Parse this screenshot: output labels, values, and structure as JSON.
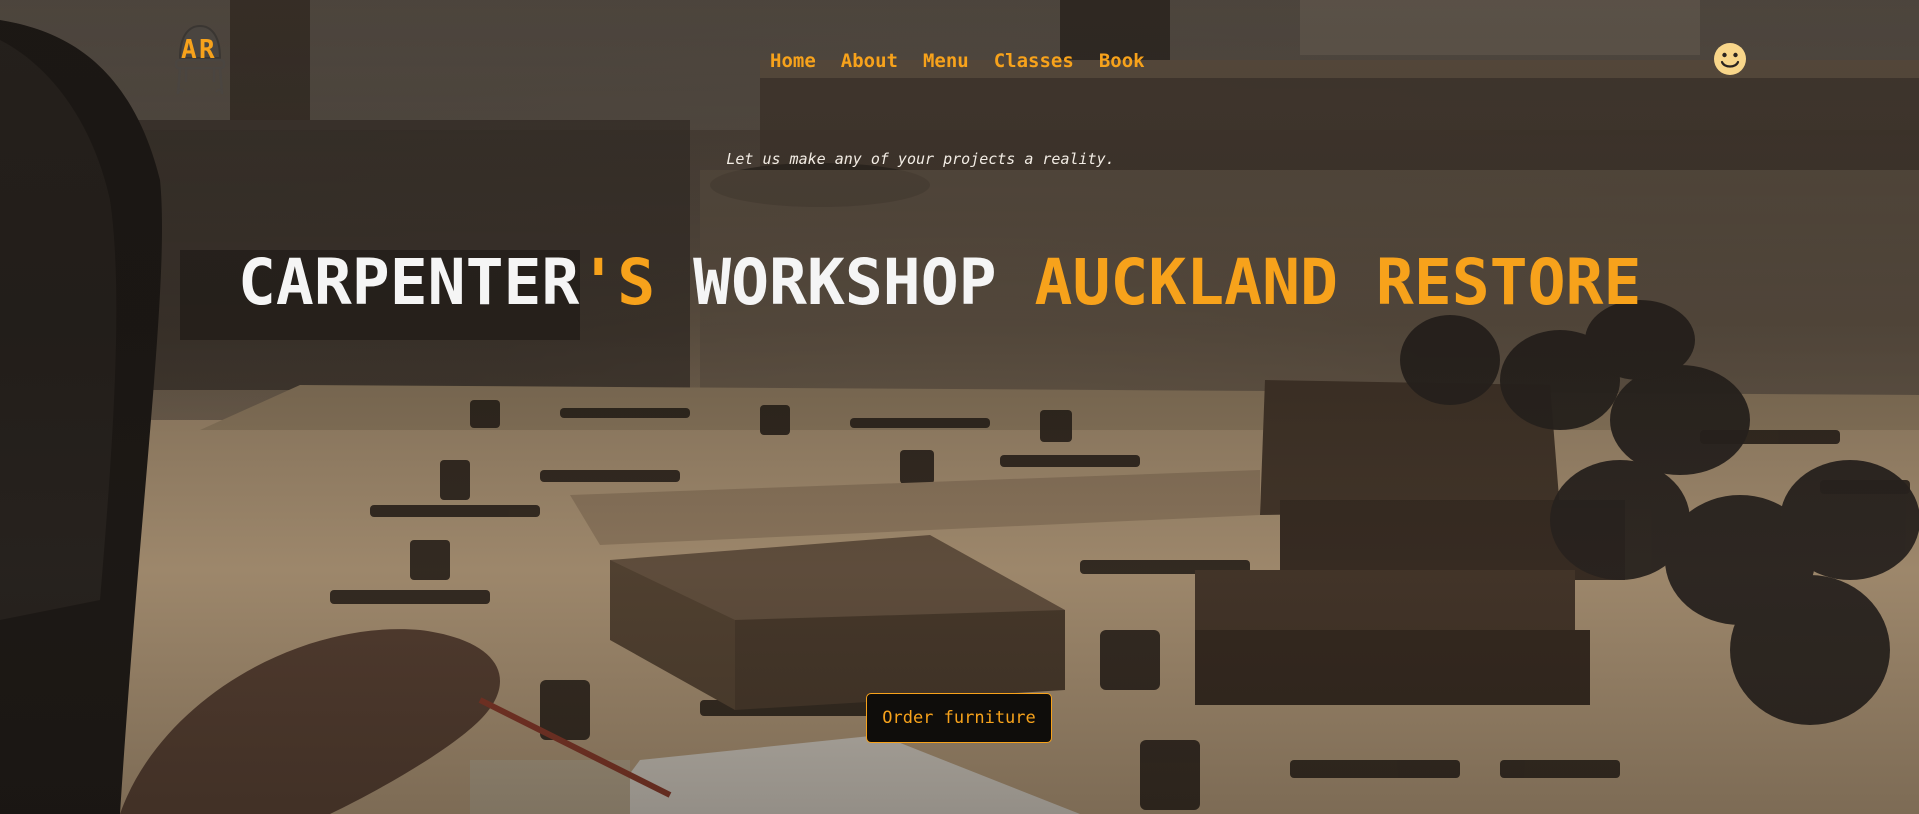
{
  "brand": {
    "logo_icon": "chair-ar-logo-icon",
    "accent_color": "#f7a21b"
  },
  "nav": {
    "items": [
      {
        "label": "Home"
      },
      {
        "label": "About"
      },
      {
        "label": "Menu"
      },
      {
        "label": "Classes"
      },
      {
        "label": "Book"
      }
    ]
  },
  "header": {
    "user_icon": "smiley-face-icon"
  },
  "hero": {
    "tagline": "Let us make any of your projects a reality.",
    "headline": {
      "part1": "CARPENTER",
      "part2": "'S",
      "part3": " WORKSHOP ",
      "part4": "AUCKLAND RESTORE"
    },
    "cta_label": "Order furniture",
    "background_image": "carpentry-workshop-photo"
  }
}
